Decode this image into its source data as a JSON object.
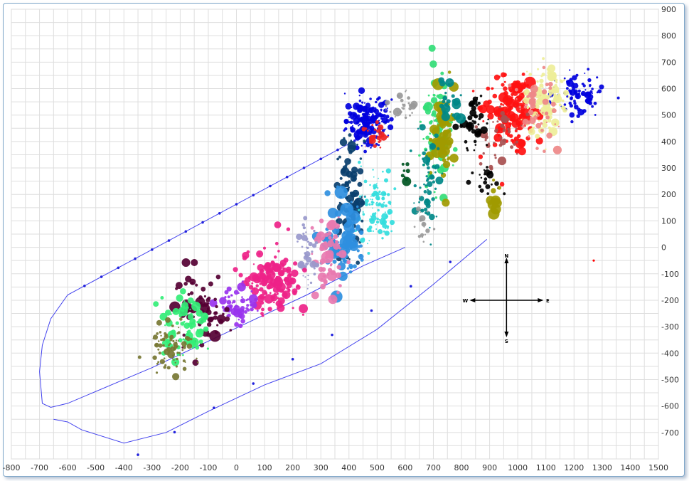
{
  "chart_data": {
    "type": "scatter",
    "title": "",
    "xlabel": "",
    "ylabel": "",
    "xlim": [
      -800,
      1500
    ],
    "ylim": [
      -800,
      900
    ],
    "x_ticks": [
      -800,
      -700,
      -600,
      -500,
      -400,
      -300,
      -200,
      -100,
      0,
      100,
      200,
      300,
      400,
      500,
      600,
      700,
      800,
      900,
      1000,
      1100,
      1200,
      1300,
      1400,
      1500
    ],
    "x_tick_labels": [
      "-800",
      "-700",
      "-600",
      "-500",
      "-400",
      "-300",
      "-200",
      "-100",
      "0",
      "100",
      "200",
      "300",
      "400",
      "500",
      "600",
      "700",
      "800",
      "900",
      "1000",
      "1100",
      "1200",
      "1300",
      "1400",
      "1500"
    ],
    "y_ticks": [
      900,
      800,
      700,
      600,
      500,
      400,
      300,
      200,
      100,
      0,
      -100,
      -200,
      -300,
      -400,
      -500,
      -600,
      -700
    ],
    "y_tick_labels": [
      "900",
      "800",
      "700",
      "600",
      "500",
      "400",
      "300",
      "200",
      "100",
      "0",
      "-100",
      "-200",
      "-300",
      "-400",
      "-500",
      "-600",
      "-700"
    ],
    "grid": true,
    "y_axis_side": "right",
    "bubble_clusters": [
      {
        "color": "#0000dd",
        "cx": 470,
        "cy": 480,
        "sx": 40,
        "sy": 45,
        "n": 170,
        "size": 2.6
      },
      {
        "color": "#0000dd",
        "cx": 1210,
        "cy": 580,
        "sx": 45,
        "sy": 40,
        "n": 90,
        "size": 2.4
      },
      {
        "color": "#ff1111",
        "cx": 970,
        "cy": 520,
        "sx": 45,
        "sy": 70,
        "n": 150,
        "size": 3.4
      },
      {
        "color": "#ee2222",
        "cx": 500,
        "cy": 420,
        "sx": 30,
        "sy": 25,
        "n": 30,
        "size": 2.0
      },
      {
        "color": "#eeee99",
        "cx": 1100,
        "cy": 560,
        "sx": 35,
        "sy": 65,
        "n": 110,
        "size": 3.0
      },
      {
        "color": "#ee8888",
        "cx": 1060,
        "cy": 520,
        "sx": 40,
        "sy": 70,
        "n": 60,
        "size": 2.6
      },
      {
        "color": "#a85050",
        "cx": 930,
        "cy": 430,
        "sx": 40,
        "sy": 60,
        "n": 50,
        "size": 2.8
      },
      {
        "color": "#000000",
        "cx": 850,
        "cy": 470,
        "sx": 25,
        "sy": 60,
        "n": 50,
        "size": 3.0
      },
      {
        "color": "#000000",
        "cx": 900,
        "cy": 240,
        "sx": 20,
        "sy": 35,
        "n": 20,
        "size": 3.0
      },
      {
        "color": "#33dd77",
        "cx": 710,
        "cy": 450,
        "sx": 25,
        "sy": 110,
        "n": 90,
        "size": 3.4
      },
      {
        "color": "#a09a00",
        "cx": 740,
        "cy": 400,
        "sx": 20,
        "sy": 90,
        "n": 55,
        "size": 4.6
      },
      {
        "color": "#a09a00",
        "cx": 920,
        "cy": 180,
        "sx": 15,
        "sy": 25,
        "n": 12,
        "size": 4.0
      },
      {
        "color": "#008888",
        "cx": 680,
        "cy": 250,
        "sx": 20,
        "sy": 90,
        "n": 60,
        "size": 2.6
      },
      {
        "color": "#008888",
        "cx": 760,
        "cy": 560,
        "sx": 20,
        "sy": 40,
        "n": 25,
        "size": 3.0
      },
      {
        "color": "#999999",
        "cx": 590,
        "cy": 520,
        "sx": 25,
        "sy": 35,
        "n": 30,
        "size": 2.4
      },
      {
        "color": "#999999",
        "cx": 660,
        "cy": 80,
        "sx": 15,
        "sy": 40,
        "n": 20,
        "size": 2.2
      },
      {
        "color": "#0a3f6e",
        "cx": 405,
        "cy": 200,
        "sx": 25,
        "sy": 100,
        "n": 100,
        "size": 3.2
      },
      {
        "color": "#33dddd",
        "cx": 500,
        "cy": 150,
        "sx": 30,
        "sy": 80,
        "n": 110,
        "size": 2.0
      },
      {
        "color": "#2f8fe0",
        "cx": 380,
        "cy": 30,
        "sx": 40,
        "sy": 80,
        "n": 90,
        "size": 4.2
      },
      {
        "color": "#e87ab0",
        "cx": 330,
        "cy": -50,
        "sx": 25,
        "sy": 80,
        "n": 60,
        "size": 3.4
      },
      {
        "color": "#9999cc",
        "cx": 250,
        "cy": -30,
        "sx": 20,
        "sy": 50,
        "n": 50,
        "size": 2.4
      },
      {
        "color": "#ee2288",
        "cx": 130,
        "cy": -130,
        "sx": 45,
        "sy": 60,
        "n": 160,
        "size": 3.0
      },
      {
        "color": "#9933ee",
        "cx": 10,
        "cy": -220,
        "sx": 30,
        "sy": 35,
        "n": 60,
        "size": 2.8
      },
      {
        "color": "#550033",
        "cx": -130,
        "cy": -230,
        "sx": 45,
        "sy": 70,
        "n": 70,
        "size": 4.0
      },
      {
        "color": "#33ee77",
        "cx": -180,
        "cy": -290,
        "sx": 45,
        "sy": 60,
        "n": 80,
        "size": 3.0
      },
      {
        "color": "#777733",
        "cx": -230,
        "cy": -380,
        "sx": 40,
        "sy": 40,
        "n": 80,
        "size": 2.4
      },
      {
        "color": "#005522",
        "cx": 600,
        "cy": 280,
        "sx": 15,
        "sy": 20,
        "n": 8,
        "size": 3.6
      }
    ],
    "path": {
      "color": "#4444ee",
      "points": [
        [
          450,
          420
        ],
        [
          -600,
          -180
        ],
        [
          -660,
          -270
        ],
        [
          -690,
          -370
        ],
        [
          -700,
          -470
        ],
        [
          -690,
          -590
        ],
        [
          -660,
          -605
        ],
        [
          -600,
          -590
        ],
        [
          -300,
          -455
        ],
        [
          -60,
          -335
        ],
        [
          250,
          -180
        ],
        [
          450,
          -70
        ],
        [
          600,
          0
        ]
      ],
      "extra_points": [
        [
          -650,
          -650
        ],
        [
          -600,
          -660
        ],
        [
          -550,
          -690
        ],
        [
          -400,
          -740
        ],
        [
          -250,
          -700
        ],
        [
          -100,
          -620
        ],
        [
          100,
          -520
        ],
        [
          300,
          -440
        ],
        [
          500,
          -310
        ],
        [
          700,
          -140
        ],
        [
          890,
          30
        ]
      ],
      "rail_markers_upper": [
        -540,
        -480,
        -420,
        -360,
        -300,
        -240,
        -180,
        -120,
        -60,
        0,
        60,
        120,
        180,
        240,
        300,
        360,
        420
      ],
      "rail_markers_lower": [
        -350,
        -220,
        -80,
        60,
        200,
        340,
        480,
        620,
        760
      ]
    },
    "compass": {
      "center": [
        960,
        -200
      ],
      "labels": {
        "n": "N",
        "s": "S",
        "e": "E",
        "w": "W"
      }
    },
    "red_outlier": [
      1270,
      -50
    ]
  }
}
